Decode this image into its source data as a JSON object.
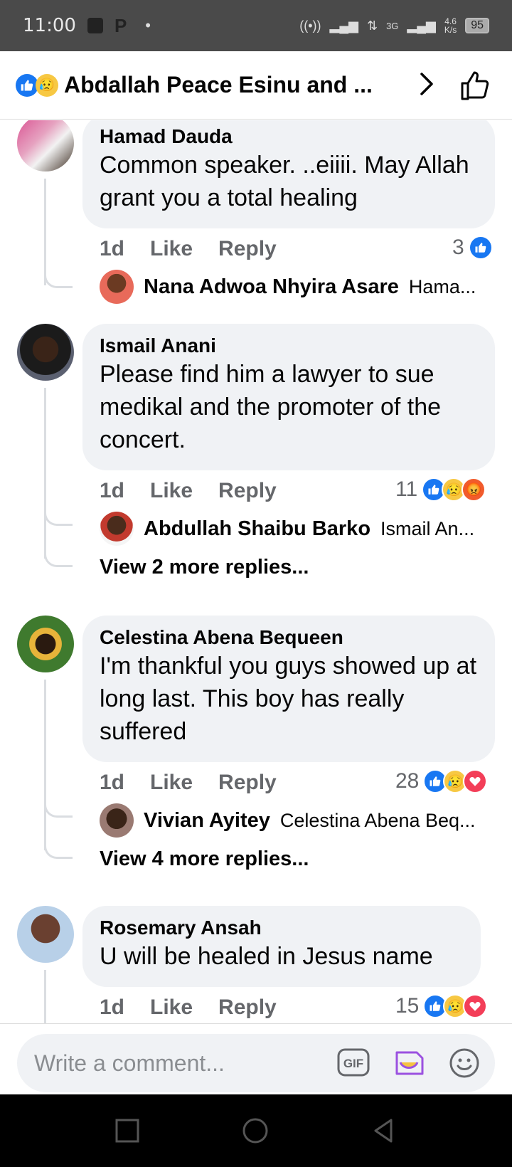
{
  "status_bar": {
    "time": "11:00",
    "p_icon": "P",
    "dot": "•",
    "net_type": "3G",
    "speed_value": "4.6",
    "speed_unit": "K/s",
    "battery": "95"
  },
  "header": {
    "title": "Abdallah Peace Esinu and ...",
    "reactions": [
      "like-icon",
      "sad-icon"
    ]
  },
  "comments": [
    {
      "author": "Hamad Dauda",
      "text": "Common speaker. ..eiiii. May Allah grant you a total healing",
      "age": "1d",
      "like_label": "Like",
      "reply_label": "Reply",
      "reaction_count": "3",
      "reactions": [
        "like"
      ],
      "reply": {
        "author": "Nana Adwoa Nhyira Asare",
        "preview": "Hama..."
      }
    },
    {
      "author": "Ismail Anani",
      "text": "Please find him a lawyer to sue medikal and the promoter of the concert.",
      "age": "1d",
      "like_label": "Like",
      "reply_label": "Reply",
      "reaction_count": "11",
      "reactions": [
        "like",
        "sad",
        "angry"
      ],
      "reply": {
        "author": "Abdullah Shaibu Barko",
        "preview": "Ismail An..."
      },
      "more_replies": "View 2 more replies..."
    },
    {
      "author": "Celestina Abena Bequeen",
      "text": "I'm thankful you guys showed up at long last. This boy has really suffered",
      "age": "1d",
      "like_label": "Like",
      "reply_label": "Reply",
      "reaction_count": "28",
      "reactions": [
        "like",
        "sad",
        "love"
      ],
      "reply": {
        "author": "Vivian Ayitey",
        "preview": "Celestina Abena Beq..."
      },
      "more_replies": "View 4 more replies..."
    },
    {
      "author": "Rosemary Ansah",
      "text": "U will be healed in Jesus name",
      "age": "1d",
      "like_label": "Like",
      "reply_label": "Reply",
      "reaction_count": "15",
      "reactions": [
        "like",
        "sad",
        "love"
      ]
    }
  ],
  "composer": {
    "placeholder": "Write a comment..."
  },
  "colors": {
    "accent": "#1877f2",
    "bubble": "#f0f2f5",
    "muted": "#65676b",
    "sad": "#f7c843",
    "angry": "#f15b2c",
    "love": "#f33e58"
  }
}
